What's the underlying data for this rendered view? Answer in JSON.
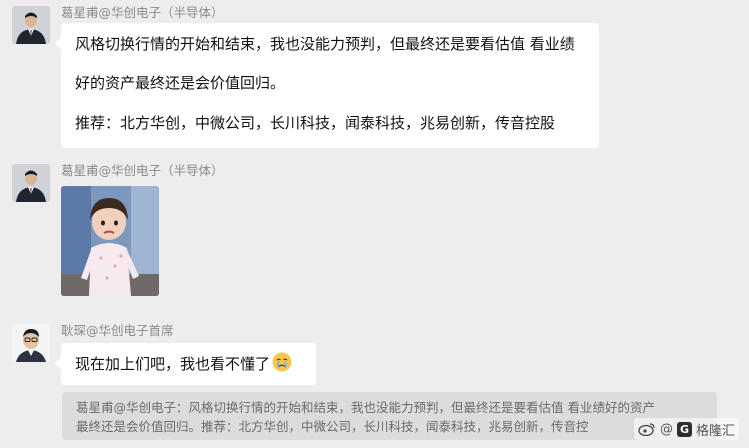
{
  "messages": [
    {
      "sender": "葛星甫@华创电子（半导体）",
      "lines": [
        "风格切换行情的开始和结束，我也没能力预判，但最终还是要看估值 看业绩",
        "好的资产最终还是会价值回归。",
        "推荐：北方华创，中微公司，长川科技，闻泰科技，兆易创新，传音控股"
      ]
    },
    {
      "sender": "葛星甫@华创电子（半导体）",
      "image": "child-photo"
    },
    {
      "sender": "耿琛@华创电子首席",
      "text": "现在加上们吧，我也看不懂了",
      "emoji": "crying-emoji"
    }
  ],
  "quote": {
    "line1": "葛星甫@华创电子：风格切换行情的开始和结束，我也没能力预判，但最终还是要看估值 看业绩好的资产",
    "line2": "最终还是会价值回归。推荐：北方华创，中微公司，长川科技，闻泰科技，兆易创新，传音控"
  },
  "watermark": {
    "prefix": "@",
    "brand": "格隆汇"
  },
  "colors": {
    "background": "#ededed",
    "bubble": "#ffffff",
    "quote_bg": "#dcdcdc"
  }
}
